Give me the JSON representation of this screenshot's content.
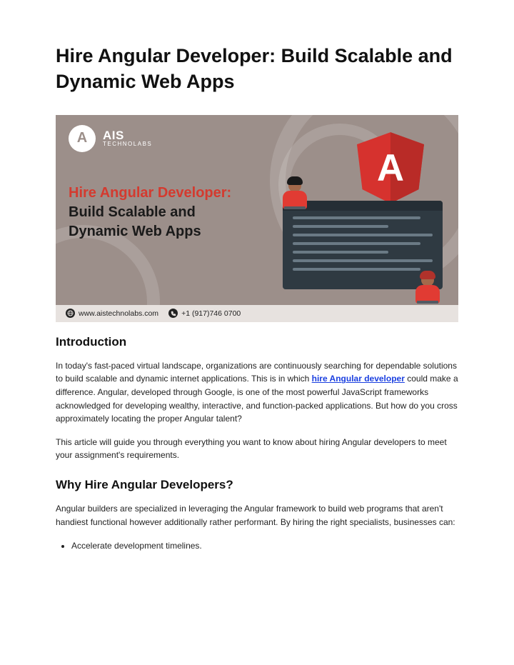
{
  "title": "Hire Angular Developer: Build Scalable and Dynamic Web Apps",
  "banner": {
    "logo_letter": "A",
    "logo_name": "AIS",
    "logo_sub": "TECHNOLABS",
    "headline_red": "Hire Angular Developer: ",
    "headline_black1": "Build Scalable and Dynamic Web Apps",
    "shield_letter": "A",
    "website": "www.aistechnolabs.com",
    "phone": "+1 (917)746 0700"
  },
  "section1": {
    "heading": "Introduction",
    "para1_a": "In today's fast-paced virtual landscape, organizations are continuously searching for dependable solutions to build scalable and dynamic internet applications. This is in which ",
    "link_text": "hire Angular developer",
    "para1_b": " could make a difference. Angular, developed through Google, is one of the most powerful JavaScript frameworks acknowledged for developing wealthy, interactive, and function-packed applications. But how do you cross approximately locating the proper Angular talent?",
    "para2": "This article will guide you through everything you want to know about hiring Angular developers to meet your assignment's requirements."
  },
  "section2": {
    "heading": "Why Hire Angular Developers?",
    "para1": "Angular builders are specialized in leveraging the Angular framework to build web programs that aren't handiest functional however additionally rather performant. By hiring the right specialists, businesses can:",
    "bullets": [
      "Accelerate development timelines."
    ]
  }
}
